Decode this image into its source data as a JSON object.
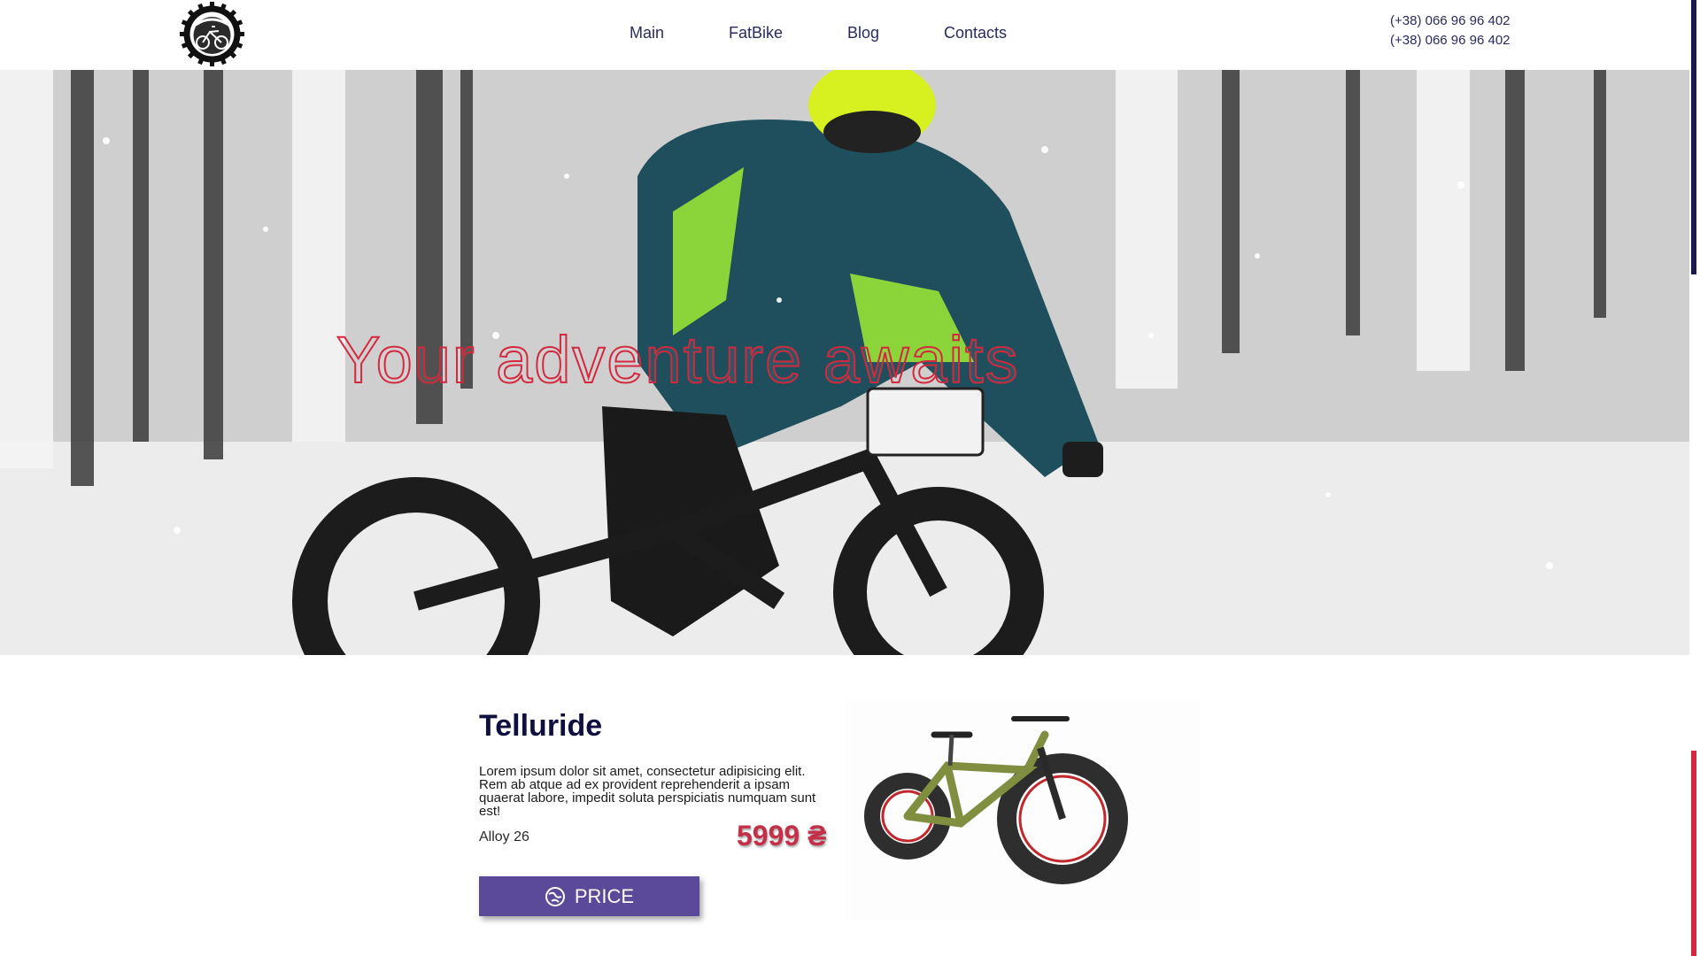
{
  "header": {
    "logo_icon": "fatbike-gear-logo",
    "nav": [
      {
        "label": "Main"
      },
      {
        "label": "FatBike"
      },
      {
        "label": "Blog"
      },
      {
        "label": "Contacts"
      }
    ],
    "phones": [
      "(+38) 066 96 96 402",
      "(+38) 066 96 96 402"
    ]
  },
  "hero": {
    "title": "Your adventure awaits",
    "image": "snow-fatbike-rider"
  },
  "product": {
    "title": "Telluride",
    "description": "Lorem ipsum dolor sit amet, consectetur adipisicing elit. Rem ab atque ad ex provident reprehenderit a ipsam quaerat labore, impedit soluta perspiciatis numquam sunt est!",
    "material": "Alloy 26",
    "price": "5999 ₴",
    "button_label": "PRICE",
    "button_icon": "globe-icon",
    "image": "green-fatbike"
  },
  "colors": {
    "accent": "#5a4a99",
    "title_red": "#d4283f",
    "nav_text": "#2a2a5e",
    "heading_dark": "#101040"
  }
}
